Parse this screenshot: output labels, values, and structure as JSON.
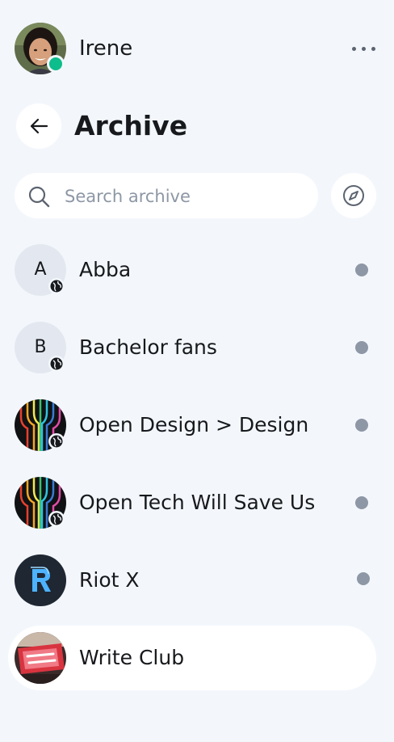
{
  "user": {
    "name": "Irene",
    "status_color": "#0dbd8b"
  },
  "header": {
    "menu_icon": "more-horizontal-icon",
    "back_icon": "arrow-left-icon",
    "title": "Archive"
  },
  "search": {
    "placeholder": "Search archive",
    "icon": "search-icon"
  },
  "explore": {
    "icon": "compass-icon"
  },
  "colors": {
    "background": "#f3f7fc",
    "surface": "#ffffff",
    "unread": "#8d97a5",
    "online": "#0dbd8b"
  },
  "rooms": [
    {
      "name": "Abba",
      "avatar_letter": "A",
      "public": true,
      "unread": true
    },
    {
      "name": "Bachelor fans",
      "avatar_letter": "B",
      "public": true,
      "unread": true
    },
    {
      "name": "Open Design > Design",
      "avatar_letter": "",
      "public": true,
      "unread": true
    },
    {
      "name": "Open Tech Will Save Us",
      "avatar_letter": "",
      "public": true,
      "unread": true
    },
    {
      "name": "Riot X",
      "avatar_letter": "",
      "public": false,
      "unread": true
    },
    {
      "name": "Write Club",
      "avatar_letter": "",
      "public": false,
      "unread": false,
      "selected": true
    }
  ]
}
